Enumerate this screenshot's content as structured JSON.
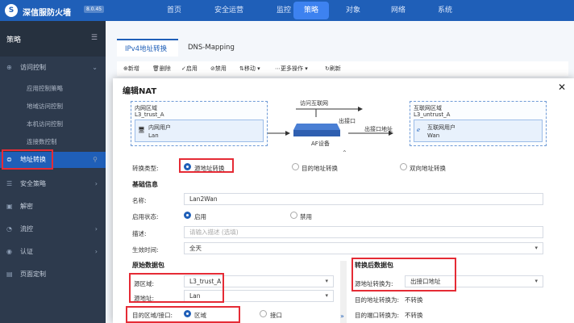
{
  "app": {
    "title": "深信服防火墙",
    "version": "8.0.45"
  },
  "nav": [
    "首页",
    "安全运营",
    "监控",
    "策略",
    "对象",
    "网络",
    "系统"
  ],
  "sidebar": {
    "header": "策略",
    "items": [
      {
        "label": "访问控制",
        "sub": [
          "应用控制策略",
          "地域访问控制",
          "本机访问控制",
          "连接数控制"
        ]
      },
      {
        "label": "地址转换"
      },
      {
        "label": "安全策略"
      },
      {
        "label": "解密"
      },
      {
        "label": "流控"
      },
      {
        "label": "认证"
      },
      {
        "label": "页面定制"
      }
    ]
  },
  "tabs": [
    "IPv4地址转换",
    "DNS-Mapping"
  ],
  "toolbar": [
    "新增",
    "删除",
    "启用",
    "禁用",
    "移动",
    "更多操作",
    "刷新"
  ],
  "modal": {
    "title": "编辑NAT",
    "diagram": {
      "src_zone_title": "内网区域",
      "src_zone": "L3_trust_A",
      "src_user": "内网用户",
      "src_net": "Lan",
      "access_label": "访问互联网",
      "device": "AF设备",
      "out_iface": "出接口",
      "out_addr": "出接口地址",
      "dst_zone_title": "互联网区域",
      "dst_zone": "L3_untrust_A",
      "dst_user": "互联网用户",
      "dst_net": "Wan"
    },
    "type_label": "转换类型:",
    "types": [
      "源地址转换",
      "目的地址转换",
      "双向地址转换"
    ],
    "basic_title": "基础信息",
    "name_label": "名称:",
    "name_value": "Lan2Wan",
    "status_label": "启用状态:",
    "status_on": "启用",
    "status_off": "禁用",
    "desc_label": "描述:",
    "desc_placeholder": "请输入描述 (选填)",
    "time_label": "生效时间:",
    "time_value": "全天",
    "orig_title": "原始数据包",
    "src_zone_label": "源区域:",
    "src_zone_value": "L3_trust_A",
    "src_addr_label": "源地址:",
    "src_addr_value": "Lan",
    "dst_label": "目的区域/接口:",
    "dst_opt1": "区域",
    "dst_opt2": "接口",
    "trans_title": "转换后数据包",
    "src_trans_label": "源地址转换为:",
    "src_trans_value": "出接口地址",
    "dst_trans_label": "目的地址转换为:",
    "dst_trans_value": "不转换",
    "port_trans_label": "目的端口转换为:",
    "port_trans_value": "不转换"
  }
}
